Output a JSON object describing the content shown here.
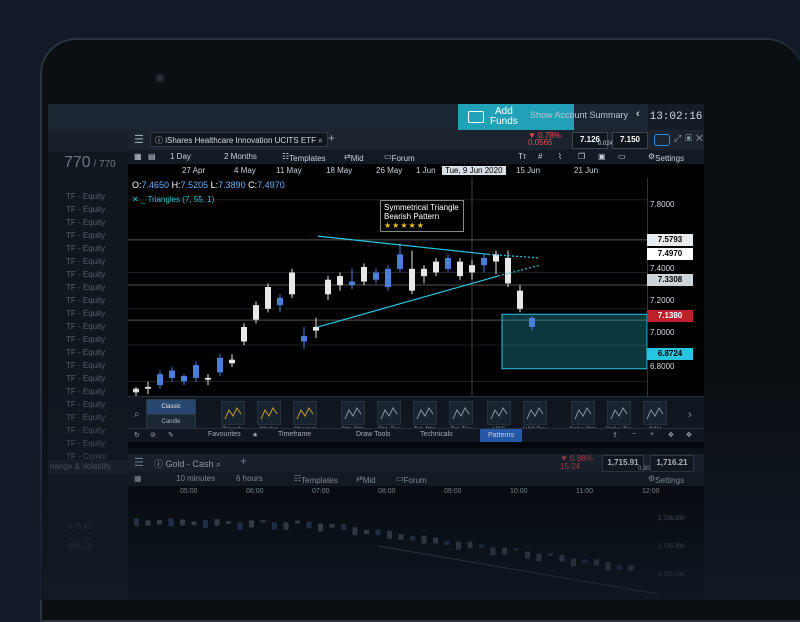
{
  "topbar": {
    "add_funds": "Add\nFunds",
    "show_account": "Show Account Summary",
    "clock": "13:02:16"
  },
  "left_panel": {
    "count": "770",
    "total": "/ 770",
    "rows": [
      "TF - Equity",
      "TF - Equity",
      "TF - Equity",
      "TF - Equity",
      "TF - Equity",
      "TF - Equity",
      "TF - Equity",
      "TF - Equity",
      "TF - Equity",
      "TF - Equity",
      "TF - Equity",
      "TF - Equity",
      "TF - Equity",
      "TF - Equity",
      "TF - Equity",
      "TF - Equity",
      "TF - Equity",
      "TF - Equity",
      "TF - Equity",
      "TF - Equity",
      "TF - Comm"
    ],
    "section": "nange & Volatility",
    "values": [
      "079.52",
      "086.29"
    ]
  },
  "chart_window": {
    "instrument": "iShares Healthcare Innovation UCITS ETF",
    "change_pct": "▼ 0.78%",
    "change_abs": "0.0565",
    "bid": "7.126",
    "spread": "0.024",
    "ask": "7.150",
    "toolbar": {
      "interval": "1 Day",
      "range": "2 Months",
      "templates": "Templates",
      "price_type": "Mid",
      "forum": "Forum",
      "settings": "Settings"
    },
    "dates": [
      "27 Apr",
      "4 May",
      "11 May",
      "18 May",
      "26 May",
      "1 Jun",
      "Tue, 9 Jun 2020",
      "15 Jun",
      "21 Jun"
    ],
    "ohlc": {
      "o_label": "O:",
      "o": "7.4650",
      "h_label": "H:",
      "h": "7.5205",
      "l_label": "L:",
      "l": "7.3890",
      "c_label": "C:",
      "c": "7.4970"
    },
    "indicator": "Triangles (7, 55, 1)",
    "pattern_label_1": "Symmetrical Triangle",
    "pattern_label_2": "Bearish Pattern",
    "pattern_stars": "★★★★★",
    "y_axis": [
      "7.8000",
      "7.4000",
      "7.2000",
      "7.0000",
      "6.8000"
    ],
    "price_tags": {
      "upper": "7.5793",
      "current": "7.4970",
      "mid": "7.3308",
      "last": "7.1380",
      "lower": "6.8724"
    }
  },
  "chart_data": {
    "type": "candlestick",
    "x": [
      "27 Apr",
      "4 May",
      "11 May",
      "18 May",
      "26 May",
      "1 Jun",
      "9 Jun",
      "15 Jun"
    ],
    "ylim": [
      6.72,
      7.92
    ],
    "candles": [
      {
        "o": 6.74,
        "h": 6.77,
        "l": 6.71,
        "c": 6.76,
        "bull": false
      },
      {
        "o": 6.76,
        "h": 6.8,
        "l": 6.73,
        "c": 6.77,
        "bull": false
      },
      {
        "o": 6.78,
        "h": 6.86,
        "l": 6.76,
        "c": 6.84,
        "bull": true
      },
      {
        "o": 6.82,
        "h": 6.88,
        "l": 6.8,
        "c": 6.86,
        "bull": true
      },
      {
        "o": 6.8,
        "h": 6.84,
        "l": 6.78,
        "c": 6.83,
        "bull": true
      },
      {
        "o": 6.82,
        "h": 6.91,
        "l": 6.8,
        "c": 6.89,
        "bull": true
      },
      {
        "o": 6.81,
        "h": 6.84,
        "l": 6.78,
        "c": 6.82,
        "bull": false
      },
      {
        "o": 6.85,
        "h": 6.95,
        "l": 6.83,
        "c": 6.93,
        "bull": true
      },
      {
        "o": 6.9,
        "h": 6.95,
        "l": 6.88,
        "c": 6.92,
        "bull": false
      },
      {
        "o": 7.02,
        "h": 7.12,
        "l": 7.0,
        "c": 7.1,
        "bull": false
      },
      {
        "o": 7.14,
        "h": 7.24,
        "l": 7.12,
        "c": 7.22,
        "bull": false
      },
      {
        "o": 7.2,
        "h": 7.34,
        "l": 7.18,
        "c": 7.32,
        "bull": false
      },
      {
        "o": 7.22,
        "h": 7.28,
        "l": 7.18,
        "c": 7.26,
        "bull": true
      },
      {
        "o": 7.28,
        "h": 7.42,
        "l": 7.26,
        "c": 7.4,
        "bull": false
      },
      {
        "o": 7.05,
        "h": 7.1,
        "l": 6.98,
        "c": 7.02,
        "bull": true
      },
      {
        "o": 7.1,
        "h": 7.15,
        "l": 7.04,
        "c": 7.08,
        "bull": false
      },
      {
        "o": 7.28,
        "h": 7.38,
        "l": 7.25,
        "c": 7.36,
        "bull": false
      },
      {
        "o": 7.33,
        "h": 7.4,
        "l": 7.3,
        "c": 7.38,
        "bull": false
      },
      {
        "o": 7.33,
        "h": 7.42,
        "l": 7.31,
        "c": 7.35,
        "bull": true
      },
      {
        "o": 7.35,
        "h": 7.45,
        "l": 7.33,
        "c": 7.43,
        "bull": false
      },
      {
        "o": 7.36,
        "h": 7.42,
        "l": 7.34,
        "c": 7.4,
        "bull": true
      },
      {
        "o": 7.32,
        "h": 7.44,
        "l": 7.3,
        "c": 7.42,
        "bull": true
      },
      {
        "o": 7.5,
        "h": 7.56,
        "l": 7.4,
        "c": 7.42,
        "bull": true
      },
      {
        "o": 7.42,
        "h": 7.52,
        "l": 7.28,
        "c": 7.3,
        "bull": false
      },
      {
        "o": 7.38,
        "h": 7.44,
        "l": 7.34,
        "c": 7.42,
        "bull": false
      },
      {
        "o": 7.4,
        "h": 7.48,
        "l": 7.38,
        "c": 7.46,
        "bull": false
      },
      {
        "o": 7.42,
        "h": 7.5,
        "l": 7.4,
        "c": 7.48,
        "bull": true
      },
      {
        "o": 7.38,
        "h": 7.48,
        "l": 7.36,
        "c": 7.46,
        "bull": false
      },
      {
        "o": 7.4,
        "h": 7.47,
        "l": 7.36,
        "c": 7.44,
        "bull": false
      },
      {
        "o": 7.44,
        "h": 7.5,
        "l": 7.4,
        "c": 7.48,
        "bull": true
      },
      {
        "o": 7.46,
        "h": 7.52,
        "l": 7.39,
        "c": 7.5,
        "bull": false
      },
      {
        "o": 7.48,
        "h": 7.52,
        "l": 7.32,
        "c": 7.34,
        "bull": false
      },
      {
        "o": 7.3,
        "h": 7.33,
        "l": 7.18,
        "c": 7.2,
        "bull": false
      },
      {
        "o": 7.15,
        "h": 7.16,
        "l": 7.08,
        "c": 7.1,
        "bull": true
      }
    ],
    "trend_upper": [
      [
        7.58,
        7.6
      ],
      [
        7.52,
        7.5
      ]
    ],
    "trend_lower": [
      [
        7.1,
        7.12
      ],
      [
        7.38,
        7.4
      ]
    ]
  },
  "patterns_panel": {
    "classic": "Classic",
    "candle": "Candle",
    "items": [
      "Triangle",
      "Wedge",
      "Channel",
      "Dbl. Btm",
      "Dbl. Top",
      "Tpl. Btm",
      "Tpl. Top",
      "H&S",
      "H&S Rev",
      "Spike Btm",
      "Spike Top",
      "C&H"
    ],
    "tabs": [
      "Favourites",
      "Timeframe",
      "Draw Tools",
      "Technicals",
      "Patterns"
    ]
  },
  "gold_window": {
    "instrument": "Gold - Cash",
    "change_pct": "▼ 0.88%",
    "change_abs": "15.24",
    "bid": "1,715.91",
    "spread": "0.30",
    "ask": "1,716.21",
    "interval": "10 minutes",
    "range": "6 hours",
    "templates": "Templates",
    "price_type": "Mid",
    "forum": "Forum",
    "settings": "Settings",
    "times": [
      "05:00",
      "06:00",
      "07:00",
      "08:00",
      "09:00",
      "10:00",
      "11:00",
      "12:00"
    ],
    "y_axis": [
      "1,728.000",
      "1,725.000",
      "1,722.000"
    ]
  }
}
